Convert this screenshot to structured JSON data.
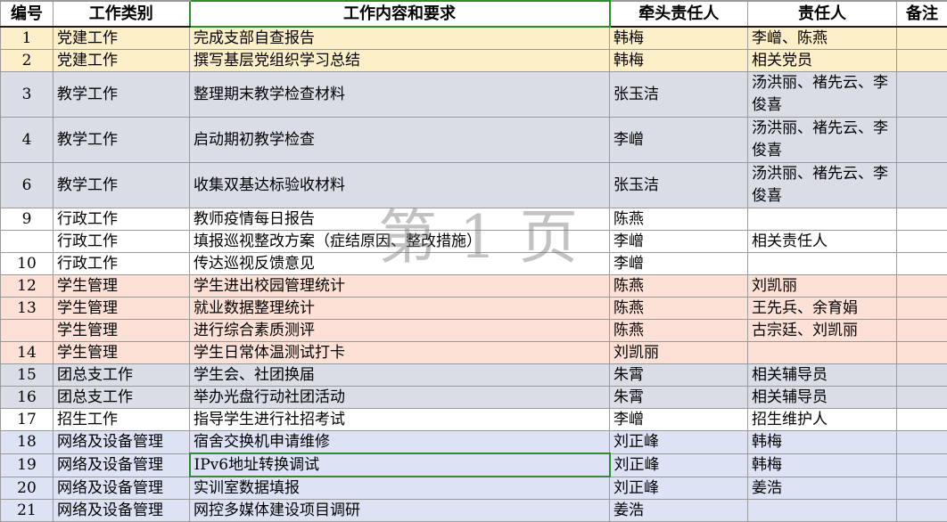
{
  "sheet": {
    "headers": {
      "id": "编号",
      "category": "工作类别",
      "content": "工作内容和要求",
      "lead": "牵头责任人",
      "owner": "责任人",
      "note": "备注"
    },
    "rows": [
      {
        "id": "1",
        "category": "党建工作",
        "content": "完成支部自查报告",
        "lead": "韩梅",
        "owner": "李嶒、陈燕",
        "note": "",
        "color": "yellow"
      },
      {
        "id": "2",
        "category": "党建工作",
        "content": "撰写基层党组织学习总结",
        "lead": "韩梅",
        "owner": "相关党员",
        "note": "",
        "color": "yellow"
      },
      {
        "id": "3",
        "category": "教学工作",
        "content": "整理期末教学检查材料",
        "lead": "张玉洁",
        "owner": "汤洪丽、褚先云、李俊喜",
        "note": "",
        "color": "gray"
      },
      {
        "id": "4",
        "category": "教学工作",
        "content": "启动期初教学检查",
        "lead": "李嶒",
        "owner": "汤洪丽、褚先云、李俊喜",
        "note": "",
        "color": "gray"
      },
      {
        "id": "6",
        "category": "教学工作",
        "content": "收集双基达标验收材料",
        "lead": "张玉洁",
        "owner": "汤洪丽、褚先云、李俊喜",
        "note": "",
        "color": "gray"
      },
      {
        "id": "9",
        "category": "行政工作",
        "content": "教师疫情每日报告",
        "lead": "陈燕",
        "owner": "",
        "note": "",
        "color": "white"
      },
      {
        "id": "",
        "category": "行政工作",
        "content": "填报巡视整改方案（症结原因、整改措施）",
        "lead": "李嶒",
        "owner": "相关责任人",
        "note": "",
        "color": "white"
      },
      {
        "id": "10",
        "category": "行政工作",
        "content": "传达巡视反馈意见",
        "lead": "李嶒",
        "owner": "",
        "note": "",
        "color": "white"
      },
      {
        "id": "12",
        "category": "学生管理",
        "content": "学生进出校园管理统计",
        "lead": "陈燕",
        "owner": "刘凯丽",
        "note": "",
        "color": "pink"
      },
      {
        "id": "13",
        "category": "学生管理",
        "content": "就业数据整理统计",
        "lead": "陈燕",
        "owner": "王先兵、余育娟",
        "note": "",
        "color": "pink"
      },
      {
        "id": "",
        "category": "学生管理",
        "content": "进行综合素质测评",
        "lead": "陈燕",
        "owner": "古宗廷、刘凯丽",
        "note": "",
        "color": "pink"
      },
      {
        "id": "14",
        "category": "学生管理",
        "content": "学生日常体温测试打卡",
        "lead": "刘凯丽",
        "owner": "",
        "note": "",
        "color": "pink"
      },
      {
        "id": "15",
        "category": "团总支工作",
        "content": "学生会、社团换届",
        "lead": "朱霄",
        "owner": "相关辅导员",
        "note": "",
        "color": "gray"
      },
      {
        "id": "16",
        "category": "团总支工作",
        "content": "举办光盘行动社团活动",
        "lead": "朱霄",
        "owner": "相关辅导员",
        "note": "",
        "color": "gray"
      },
      {
        "id": "17",
        "category": "招生工作",
        "content": "指导学生进行社招考试",
        "lead": "李嶒",
        "owner": "招生维护人",
        "note": "",
        "color": "white"
      },
      {
        "id": "18",
        "category": "网络及设备管理",
        "content": "宿舍交换机申请维修",
        "lead": "刘正峰",
        "owner": "韩梅",
        "note": "",
        "color": "blue"
      },
      {
        "id": "19",
        "category": "网络及设备管理",
        "content": "IPv6地址转换调试",
        "lead": "刘正峰",
        "owner": "韩梅",
        "note": "",
        "color": "blue"
      },
      {
        "id": "20",
        "category": "网络及设备管理",
        "content": "实训室数据填报",
        "lead": "刘正峰",
        "owner": "姜浩",
        "note": "",
        "color": "blue"
      },
      {
        "id": "21",
        "category": "网络及设备管理",
        "content": "网控多媒体建设项目调研",
        "lead": "姜浩",
        "owner": "",
        "note": "",
        "color": "blue"
      }
    ],
    "watermark": "第 1 页"
  }
}
